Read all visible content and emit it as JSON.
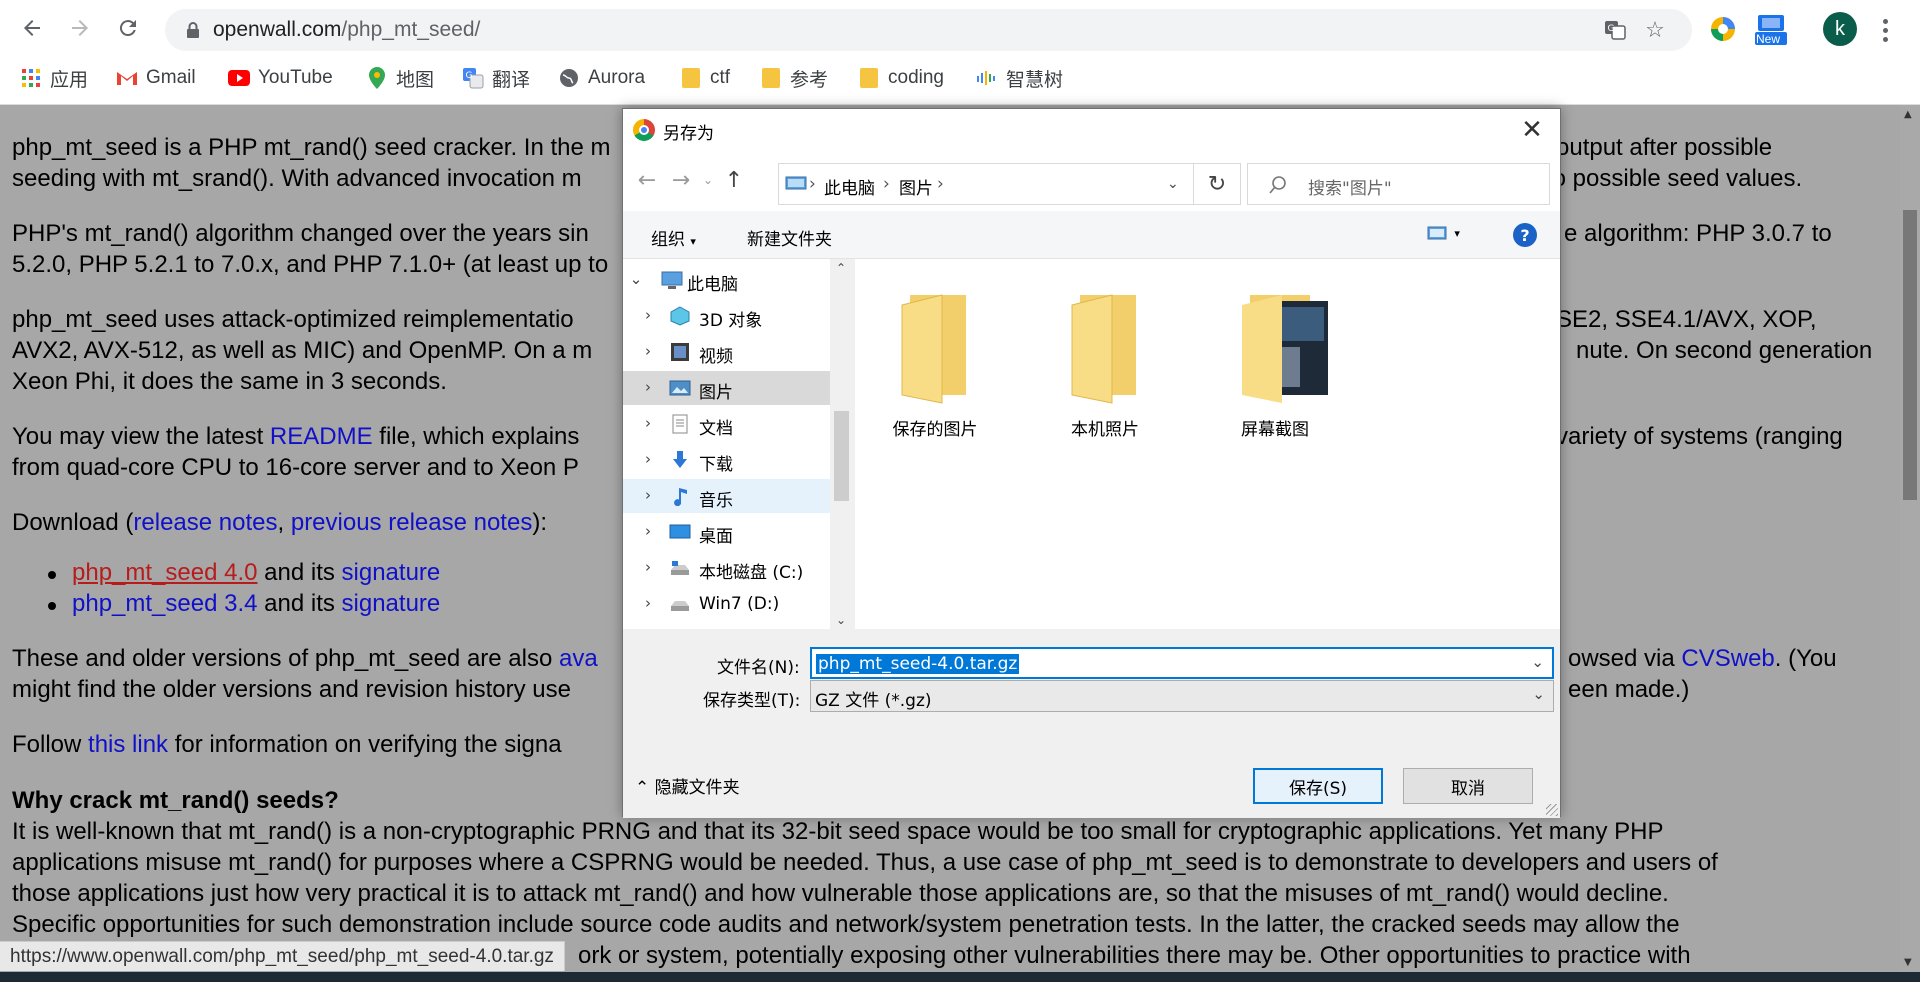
{
  "browser": {
    "url_host": "openwall.com",
    "url_path": "/php_mt_seed/",
    "ext_new_badge": "New",
    "profile_initial": "k"
  },
  "bookmarks": [
    {
      "label": "应用",
      "icon": "apps-grid-icon"
    },
    {
      "label": "Gmail",
      "icon": "gmail-icon"
    },
    {
      "label": "YouTube",
      "icon": "youtube-icon"
    },
    {
      "label": "地图",
      "icon": "maps-pin-icon"
    },
    {
      "label": "翻译",
      "icon": "translate-icon"
    },
    {
      "label": "Aurora",
      "icon": "globe-icon"
    },
    {
      "label": "ctf",
      "icon": "folder-icon"
    },
    {
      "label": "参考",
      "icon": "folder-icon"
    },
    {
      "label": "coding",
      "icon": "folder-icon"
    },
    {
      "label": "智慧树",
      "icon": "zhihuishu-icon"
    }
  ],
  "page": {
    "p1a_left": "php_mt_seed is a PHP mt_rand() seed cracker. In the m",
    "p1a_right": "output after possible",
    "p1b_left": "seeding with mt_srand(). With advanced invocation m",
    "p1b_right": "to possible seed values.",
    "p2a_left": "PHP's mt_rand() algorithm changed over the years sin",
    "p2a_right": "e algorithm: PHP 3.0.7 to",
    "p2b_left": "5.2.0, PHP 5.2.1 to 7.0.x, and PHP 7.1.0+ (at least up to",
    "p3a_left": "php_mt_seed uses attack-optimized reimplementatio",
    "p3a_right": "SE2, SSE4.1/AVX, XOP,",
    "p3b_left": "AVX2, AVX-512, as well as MIC) and OpenMP. On a m",
    "p3b_right": "nute. On second generation",
    "p3c": "Xeon Phi, it does the same in 3 seconds.",
    "p4a_left": "You may view the latest ",
    "p4a_link": "README",
    "p4a_mid": " file, which explains ",
    "p4a_right": "variety of systems (ranging",
    "p4b_left": "from quad-core CPU to 16-core server and to Xeon P",
    "dl_prefix": "Download (",
    "dl_link1": "release notes",
    "dl_sep": ", ",
    "dl_link2": "previous release notes",
    "dl_suffix": "):",
    "li1_link": "php_mt_seed 4.0",
    "li1_mid": " and its ",
    "li1_sig": "signature",
    "li2_link": "php_mt_seed 3.4",
    "li2_mid": " and its ",
    "li2_sig": "signature",
    "p5a_left": "These and older versions of php_mt_seed are also ",
    "p5a_link": "ava",
    "p5a_right_pre": "owsed via ",
    "p5a_right_link": "CVSweb",
    "p5a_right_post": ". (You",
    "p5b_left": "might find the older versions and revision history use",
    "p5b_right": "een made.)",
    "p6_prefix": "Follow ",
    "p6_link": "this link",
    "p6_suffix": " for information on verifying the signa",
    "h_why": "Why crack mt_rand() seeds?",
    "w1": "It is well-known that mt_rand() is a non-cryptographic PRNG and that its 32-bit seed space would be too small for cryptographic applications. Yet many PHP",
    "w2": "applications misuse mt_rand() for purposes where a CSPRNG would be needed. Thus, a use case of php_mt_seed is to demonstrate to developers and users of",
    "w3": "those applications just how very practical it is to attack mt_rand() and how vulnerable those applications are, so that the misuses of mt_rand() would decline.",
    "w4": "Specific opportunities for such demonstration include source code audits and network/system penetration tests. In the latter, the cracked seeds may allow the",
    "w5_right": "ork or system, potentially exposing other vulnerabilities there may be. Other opportunities to practice with"
  },
  "status_url": "https://www.openwall.com/php_mt_seed/php_mt_seed-4.0.tar.gz",
  "dialog": {
    "title": "另存为",
    "breadcrumb": [
      "此电脑",
      "图片"
    ],
    "search_placeholder": "搜索\"图片\"",
    "organize": "组织",
    "new_folder": "新建文件夹",
    "tree": [
      {
        "label": "此电脑",
        "icon": "pc-icon",
        "state": "expanded"
      },
      {
        "label": "3D 对象",
        "icon": "3d-objects-icon",
        "state": "collapsed"
      },
      {
        "label": "视频",
        "icon": "videos-icon",
        "state": "collapsed"
      },
      {
        "label": "图片",
        "icon": "pictures-icon",
        "state": "selected"
      },
      {
        "label": "文档",
        "icon": "documents-icon",
        "state": "collapsed"
      },
      {
        "label": "下载",
        "icon": "downloads-icon",
        "state": "collapsed"
      },
      {
        "label": "音乐",
        "icon": "music-icon",
        "state": "hover"
      },
      {
        "label": "桌面",
        "icon": "desktop-icon",
        "state": "collapsed"
      },
      {
        "label": "本地磁盘 (C:)",
        "icon": "drive-c-icon",
        "state": "collapsed"
      },
      {
        "label": "Win7 (D:)",
        "icon": "drive-d-icon",
        "state": "collapsed"
      }
    ],
    "folders": [
      "保存的图片",
      "本机照片",
      "屏幕截图"
    ],
    "filename_label": "文件名(N):",
    "filename_value": "php_mt_seed-4.0.tar.gz",
    "filetype_label": "保存类型(T):",
    "filetype_value": "GZ 文件 (*.gz)",
    "hide_folders": "隐藏文件夹",
    "save": "保存(S)",
    "cancel": "取消"
  },
  "colors": {
    "link": "#1010c8",
    "visited_link": "#b71c1c",
    "accent": "#0078d7",
    "avatar": "#0b5d4b"
  }
}
